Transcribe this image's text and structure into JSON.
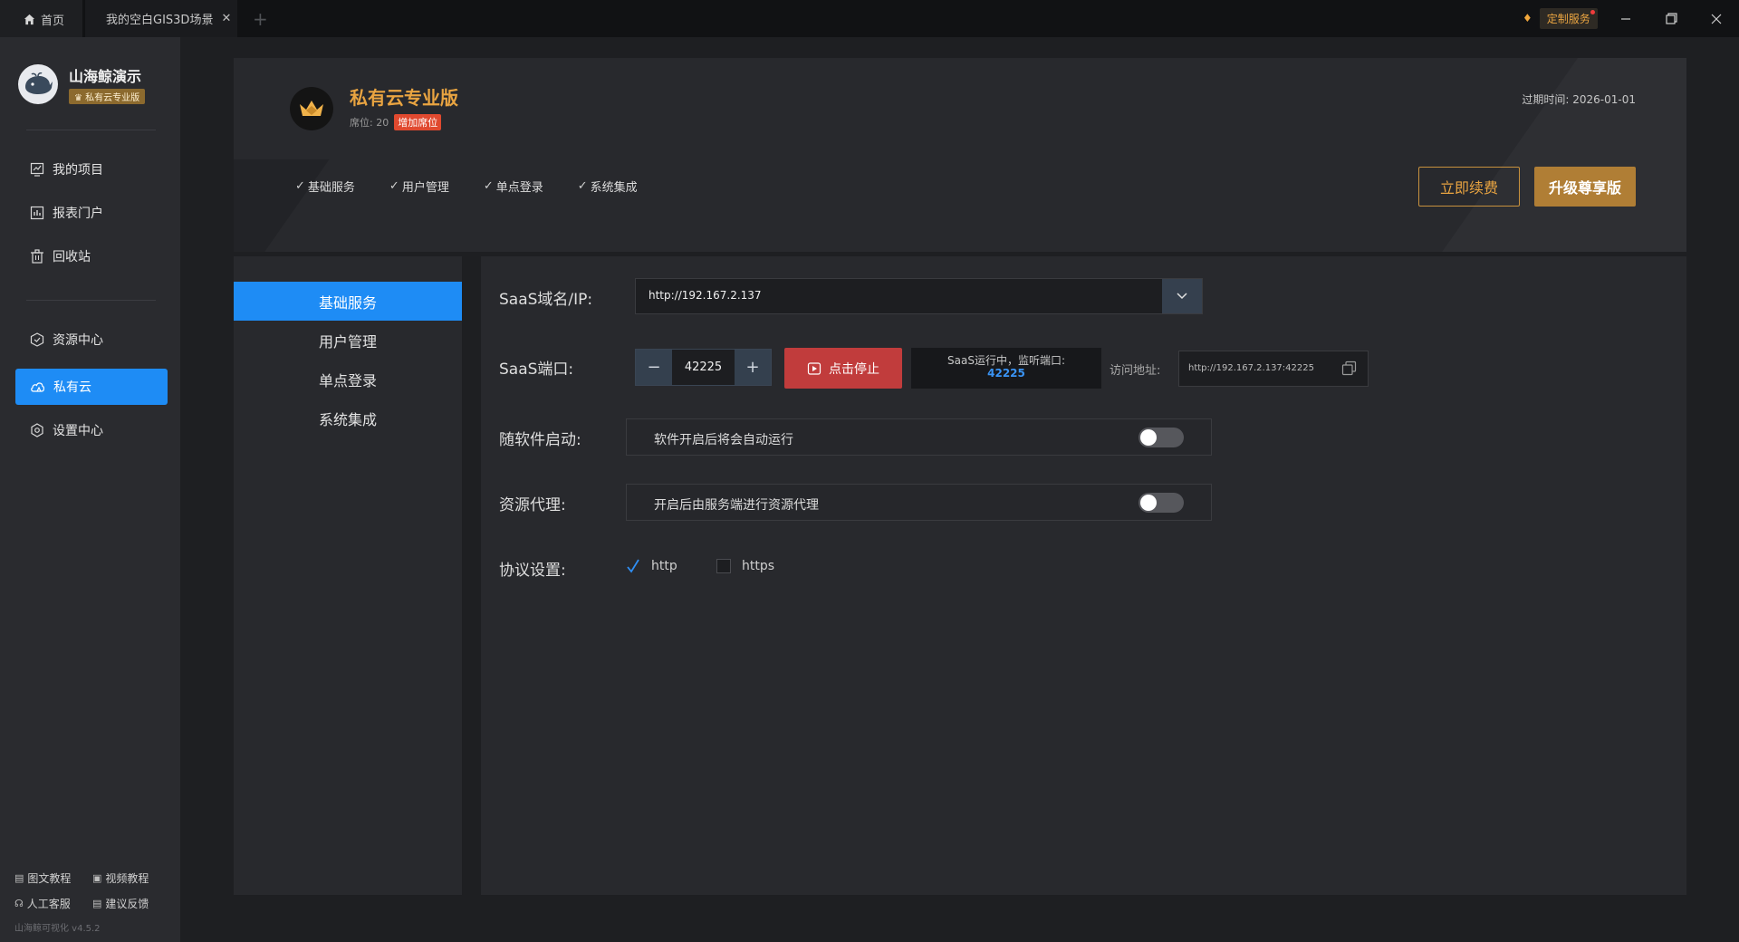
{
  "titlebar": {
    "tabs": [
      {
        "label": "首页",
        "icon": "home-icon"
      },
      {
        "label": "我的空白GIS3D场景",
        "icon": "close-icon"
      }
    ],
    "custom_service": "定制服务"
  },
  "sidebar": {
    "brand_name": "山海鲸演示",
    "brand_badge": "♛ 私有云专业版",
    "items": [
      {
        "label": "我的项目",
        "icon": "chart-board-icon"
      },
      {
        "label": "报表门户",
        "icon": "report-icon"
      },
      {
        "label": "回收站",
        "icon": "trash-icon"
      },
      {
        "label": "资源中心",
        "icon": "cube-icon"
      },
      {
        "label": "私有云",
        "icon": "cloud-icon",
        "active": true
      },
      {
        "label": "设置中心",
        "icon": "gear-icon"
      }
    ],
    "footer": {
      "tutorial_text": "图文教程",
      "tutorial_video": "视频教程",
      "support": "人工客服",
      "feedback": "建议反馈"
    },
    "version": "山海鲸可视化 v4.5.2"
  },
  "banner": {
    "plan_title": "私有云专业版",
    "seats": "席位: 20",
    "add_seat": "增加席位",
    "expire": "过期时间:  2026-01-01",
    "features": [
      "基础服务",
      "用户管理",
      "单点登录",
      "系统集成"
    ],
    "renew_button": "立即续费",
    "upgrade_button": "升级尊享版"
  },
  "submenu": {
    "items": [
      {
        "label": "基础服务",
        "active": true
      },
      {
        "label": "用户管理"
      },
      {
        "label": "单点登录"
      },
      {
        "label": "系统集成"
      }
    ]
  },
  "form": {
    "domain_label": "SaaS域名/IP:",
    "domain_value": "http://192.167.2.137",
    "port_label": "SaaS端口:",
    "port_value": "42225",
    "stop_button": "点击停止",
    "status_text": "SaaS运行中，监听端口:",
    "status_port": "42225",
    "access_label": "访问地址:",
    "access_value": "http://192.167.2.137:42225",
    "autostart_label": "随软件启动:",
    "autostart_desc": "软件开启后将会自动运行",
    "autostart_on": false,
    "proxy_label": "资源代理:",
    "proxy_desc": "开启后由服务端进行资源代理",
    "proxy_on": false,
    "protocol_label": "协议设置:",
    "protocols": [
      {
        "label": "http",
        "checked": true
      },
      {
        "label": "https",
        "checked": false
      }
    ]
  },
  "colors": {
    "accent": "#1e8cf5",
    "gold": "#e9a441",
    "danger": "#c13c3c"
  }
}
